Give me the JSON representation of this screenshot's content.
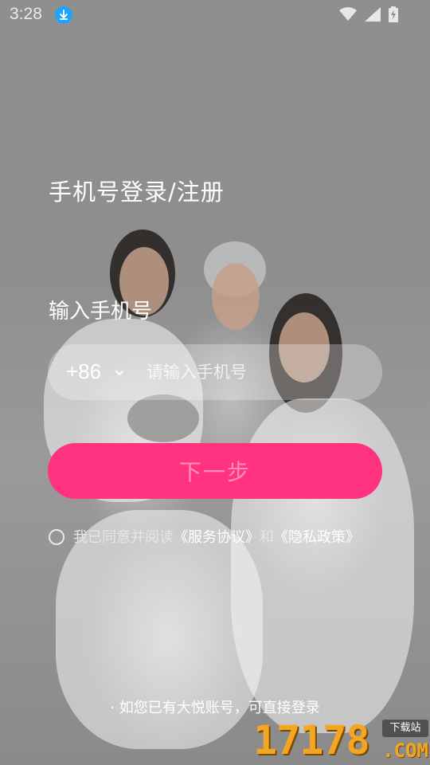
{
  "status_bar": {
    "time": "3:28",
    "download_icon": "download-arrow",
    "wifi_icon": "wifi",
    "signal_icon": "cell-signal",
    "battery_icon": "battery-charging"
  },
  "login": {
    "title": "手机号登录/注册",
    "subtitle": "输入手机号",
    "country_code": "+86",
    "phone_placeholder": "请输入手机号",
    "phone_value": "",
    "next_button": "下一步",
    "button_color": "#ff3380"
  },
  "agreement": {
    "prefix": "我已同意并阅读",
    "service_link": "《服务协议》",
    "and": "和",
    "privacy_link": "《隐私政策》",
    "checked": false
  },
  "footer": {
    "direct_login": "如您已有大悦账号，可直接登录"
  },
  "watermark": {
    "digits": "17178",
    "badge": "下载站",
    "domain": ".COM"
  }
}
